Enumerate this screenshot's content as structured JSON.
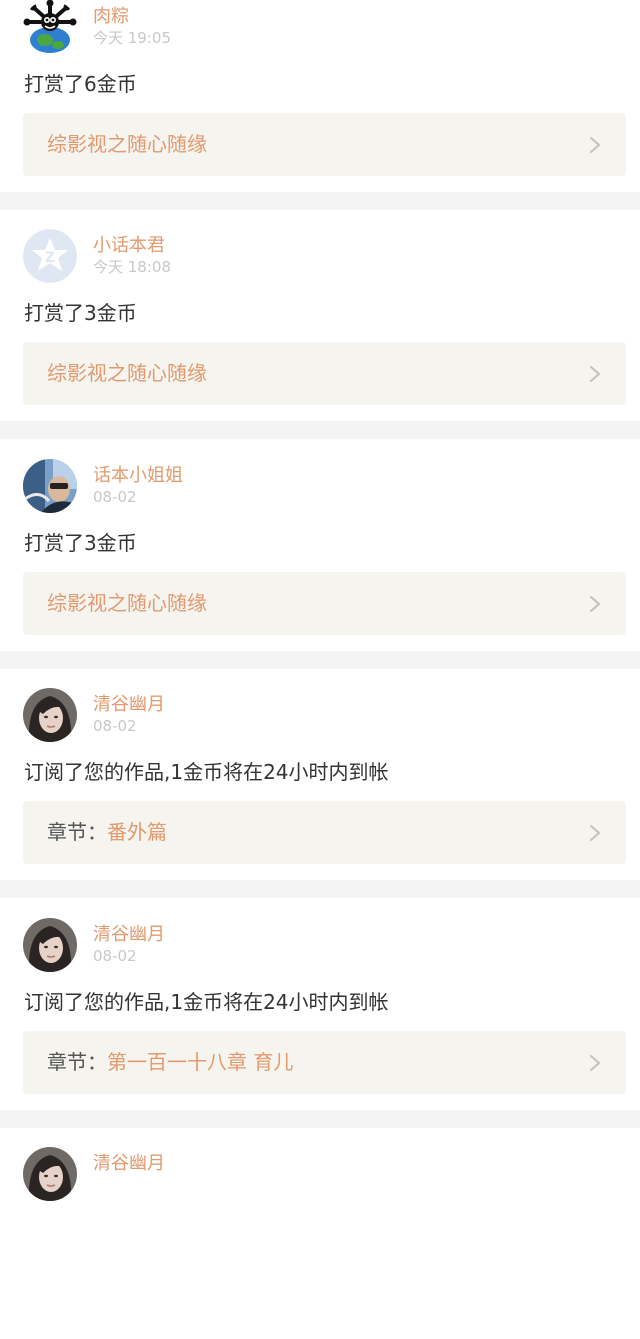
{
  "feed": {
    "items": [
      {
        "avatar_icon": "cartoon-creature-globe-icon",
        "username": "肉粽",
        "timestamp": "今天 19:05",
        "message": "打赏了6金币",
        "link_prefix": "",
        "link_title": "综影视之随心随缘"
      },
      {
        "avatar_icon": "default-user-avatar-icon",
        "username": "小话本君",
        "timestamp": "今天 18:08",
        "message": "打赏了3金币",
        "link_prefix": "",
        "link_title": "综影视之随心随缘"
      },
      {
        "avatar_icon": "photo-avatar-icon",
        "username": "话本小姐姐",
        "timestamp": "08-02",
        "message": "打赏了3金币",
        "link_prefix": "",
        "link_title": "综影视之随心随缘"
      },
      {
        "avatar_icon": "photo-avatar-icon",
        "username": "清谷幽月",
        "timestamp": "08-02",
        "message": "订阅了您的作品,1金币将在24小时内到帐",
        "link_prefix": "章节：",
        "link_title": "番外篇"
      },
      {
        "avatar_icon": "photo-avatar-icon",
        "username": "清谷幽月",
        "timestamp": "08-02",
        "message": "订阅了您的作品,1金币将在24小时内到帐",
        "link_prefix": "章节：",
        "link_title": "第一百一十八章 育儿"
      },
      {
        "avatar_icon": "photo-avatar-icon",
        "username": "清谷幽月",
        "timestamp": "",
        "message": "",
        "link_prefix": "",
        "link_title": ""
      }
    ]
  },
  "colors": {
    "accent": "#e29a6e",
    "separator": "#f4f4f4",
    "link_box_bg": "#f5f4ee",
    "timestamp": "#c8c8c8",
    "default_avatar": "#dfe7f2"
  }
}
